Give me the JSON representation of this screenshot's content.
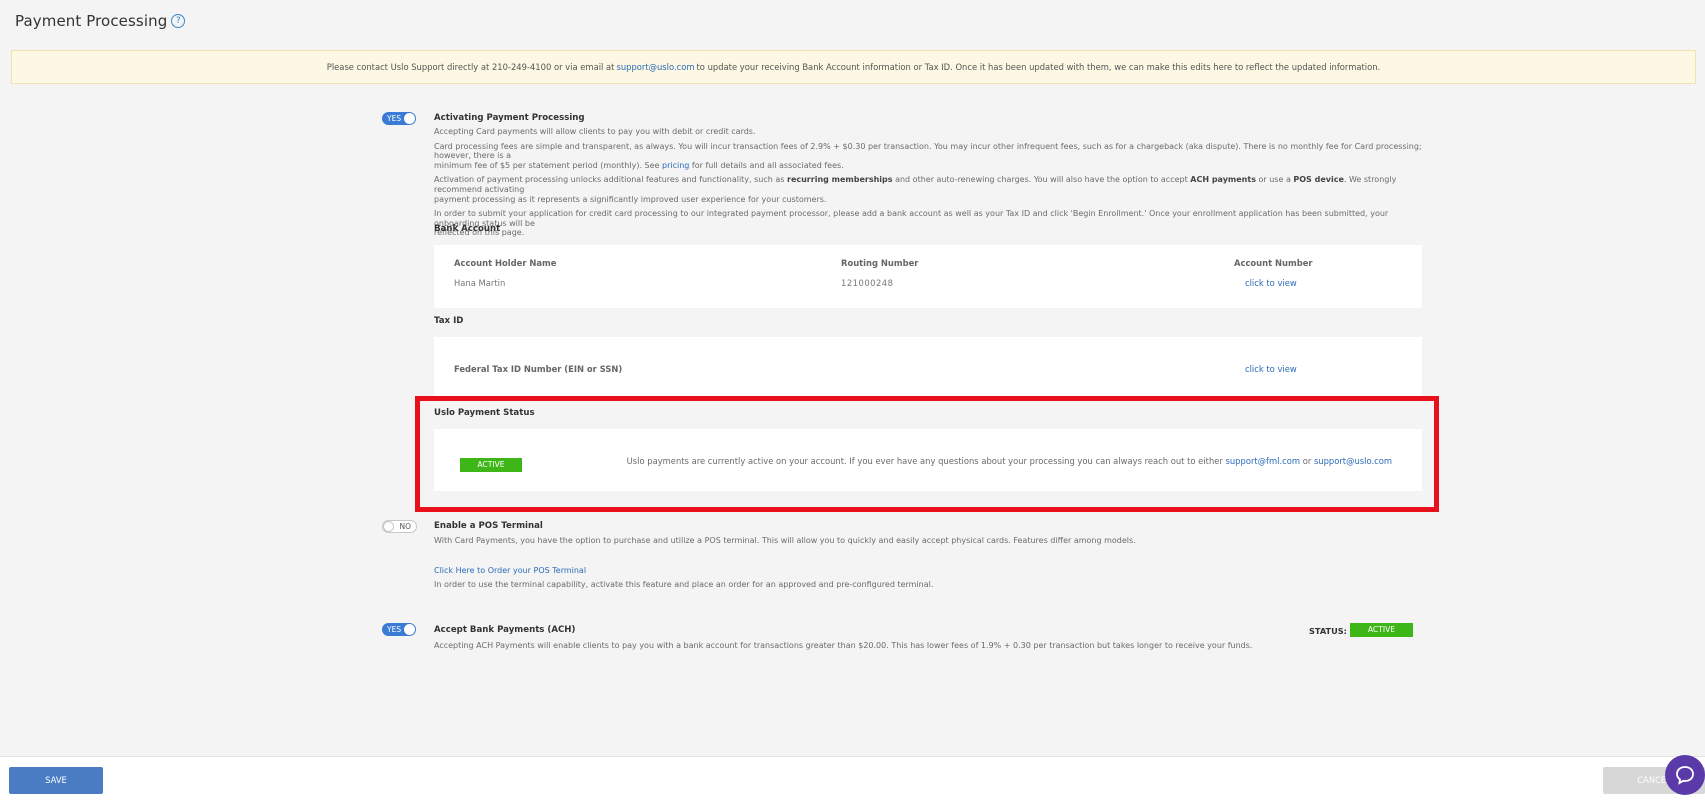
{
  "header": {
    "title": "Payment Processing",
    "help_icon": "?"
  },
  "notice": {
    "before": "Please contact Uslo Support directly at 210-249-4100 or via email at ",
    "email": "support@uslo.com",
    "after": " to update your receiving Bank Account information or Tax ID. Once it has been updated with them, we can make this edits here to reflect the updated information."
  },
  "payment_processing": {
    "toggle_label": "YES",
    "title": "Activating Payment Processing",
    "p1": "Accepting Card payments will allow clients to pay you with debit or credit cards.",
    "p2_a": "Card processing fees are simple and transparent, as always. You will incur transaction fees of 2.9% + $0.30 per transaction. You may incur other infrequent fees, such as for a chargeback (aka dispute). There is no monthly fee for Card processing; however, there is a",
    "p2_b": "minimum fee of $5 per statement period (monthly). See ",
    "p2_link": "pricing",
    "p2_c": " for full details and all associated fees.",
    "p3_a": "Activation of payment processing unlocks additional features and functionality, such as ",
    "p3_b1": "recurring memberships",
    "p3_c": " and other auto-renewing charges. You will also have the option to accept ",
    "p3_b2": "ACH payments",
    "p3_d": " or use a ",
    "p3_b3": "POS device",
    "p3_e": ". We strongly recommend activating",
    "p3_f": "payment processing as it represents a significantly improved user experience for your customers.",
    "p4_a": "In order to submit your application for credit card processing to our integrated payment processor, please add a bank account as well as your Tax ID and click 'Begin Enrollment.' Once your enrollment application has been submitted, your onboarding status will be",
    "p4_b": "reflected on this page."
  },
  "bank_account": {
    "title": "Bank Account",
    "col_holder": "Account Holder Name",
    "col_routing": "Routing Number",
    "col_account": "Account Number",
    "holder": "Hana Martin",
    "routing": "121000248",
    "account_link": "click to view"
  },
  "tax_id": {
    "title": "Tax ID",
    "label": "Federal Tax ID Number (EIN or SSN)",
    "link": "click to view"
  },
  "uslo_status": {
    "title": "Uslo Payment Status",
    "badge": "ACTIVE",
    "msg": "Uslo payments are currently active on your account. If you ever have any questions about your processing you can always reach out to either ",
    "email1": "support@fml.com",
    "or": " or ",
    "email2": "support@uslo.com"
  },
  "pos": {
    "toggle_label": "NO",
    "title": "Enable a POS Terminal",
    "p1": "With Card Payments, you have the option to purchase and utilize a POS terminal. This will allow you to quickly and easily accept physical cards. Features differ among models.",
    "link": "Click Here to Order your POS Terminal",
    "p2": "In order to use the terminal capability, activate this feature and place an order for an approved and pre-configured terminal."
  },
  "ach": {
    "toggle_label": "YES",
    "title": "Accept Bank Payments (ACH)",
    "p1": "Accepting ACH Payments will enable clients to pay you with a bank account for transactions greater than $20.00. This has lower fees of 1.9% + 0.30 per transaction but takes longer to receive your funds.",
    "status_label": "STATUS:",
    "status_badge": "ACTIVE"
  },
  "footer": {
    "save": "SAVE",
    "cancel": "CANCEL"
  },
  "colors": {
    "accent": "#3a7bd5",
    "active": "#3fb618",
    "highlight": "#e8101a",
    "chat": "#5a3aa8"
  }
}
